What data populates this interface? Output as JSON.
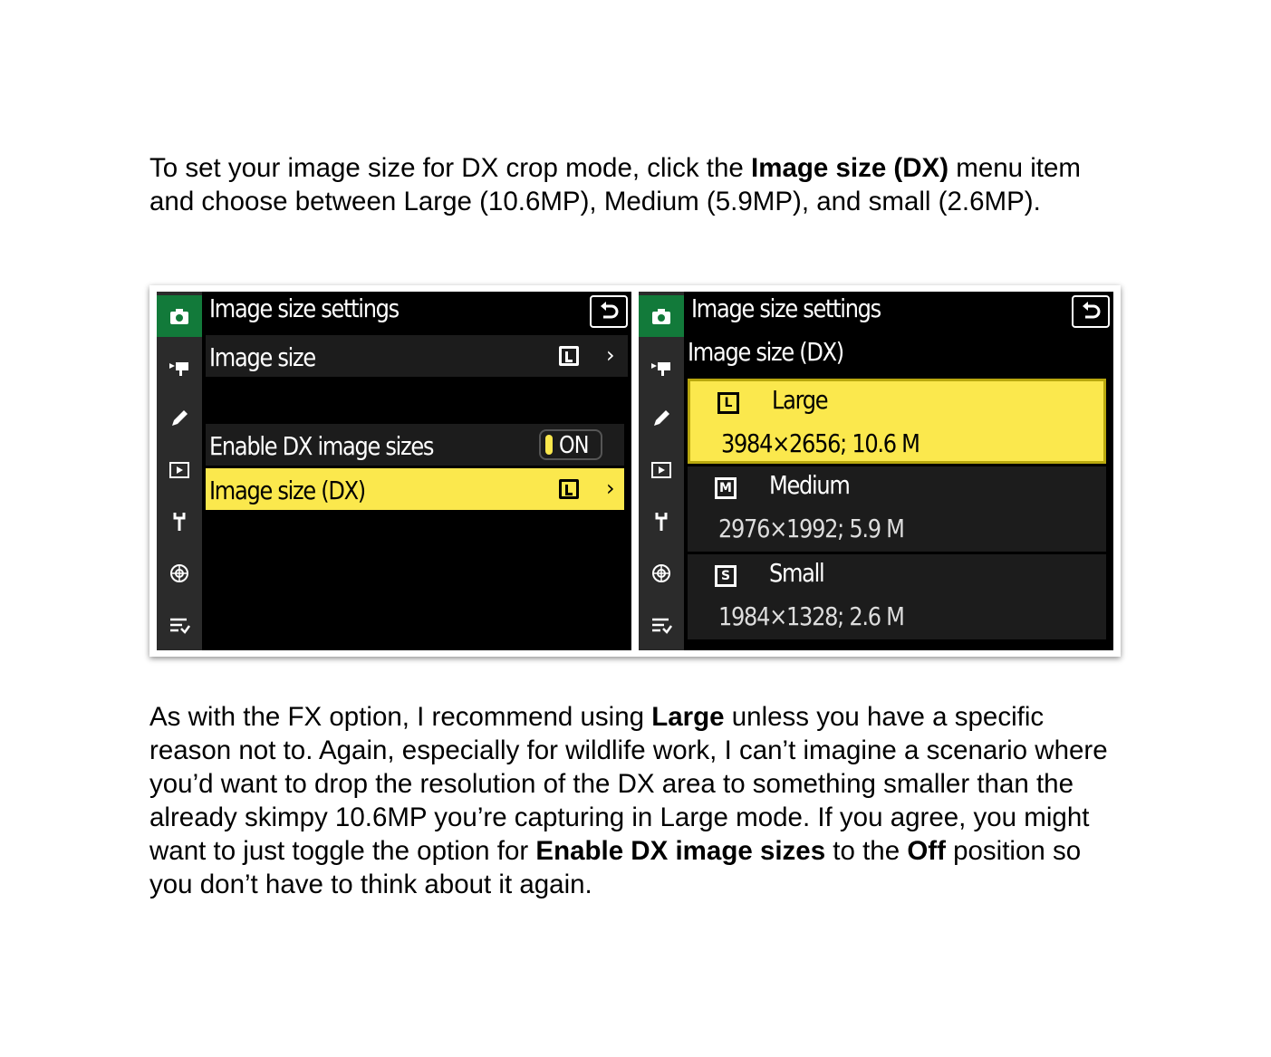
{
  "para1": {
    "t1": "To set your image size for DX crop mode, click the ",
    "b1": "Image size (DX)",
    "t2": " menu item and choose between Large (10.6MP), Medium (5.9MP), and small (2.6MP)."
  },
  "left_screen": {
    "title": "Image size settings",
    "rows": {
      "image_size": "Image size",
      "enable_dx": "Enable DX image sizes",
      "enable_dx_value": "ON",
      "image_size_dx": "Image size (DX)"
    },
    "chevron": "›"
  },
  "right_screen": {
    "title": "Image size settings",
    "subtitle": "Image size (DX)",
    "options": [
      {
        "icon": "L",
        "name": "Large",
        "res": "3984×2656; 10.6 M"
      },
      {
        "icon": "M",
        "name": "Medium",
        "res": "2976×1992;  5.9 M"
      },
      {
        "icon": "S",
        "name": "Small",
        "res": "1984×1328;  2.6 M"
      }
    ]
  },
  "colors": {
    "highlight": "#fbe84d",
    "active_tab": "#127a3a",
    "rail": "#2b2b2b"
  },
  "rail_icons": [
    "camera-icon",
    "movie-icon",
    "pencil-icon",
    "playback-icon",
    "wrench-icon",
    "network-icon",
    "my-menu-icon"
  ],
  "para2": {
    "t1": "As with the FX option, I recommend using ",
    "b1": "Large",
    "t2": " unless you have a specific reason not to. Again, especially for wildlife work, I can’t imagine a scenario where you’d want to drop the resolution of the DX area to something smaller than the already skimpy 10.6MP you’re capturing in Large mode. If you agree, you might want to just toggle the option for ",
    "b2": "Enable DX image sizes",
    "t3": " to the ",
    "b3": "Off",
    "t4": " position so you don’t have to think about it again."
  }
}
